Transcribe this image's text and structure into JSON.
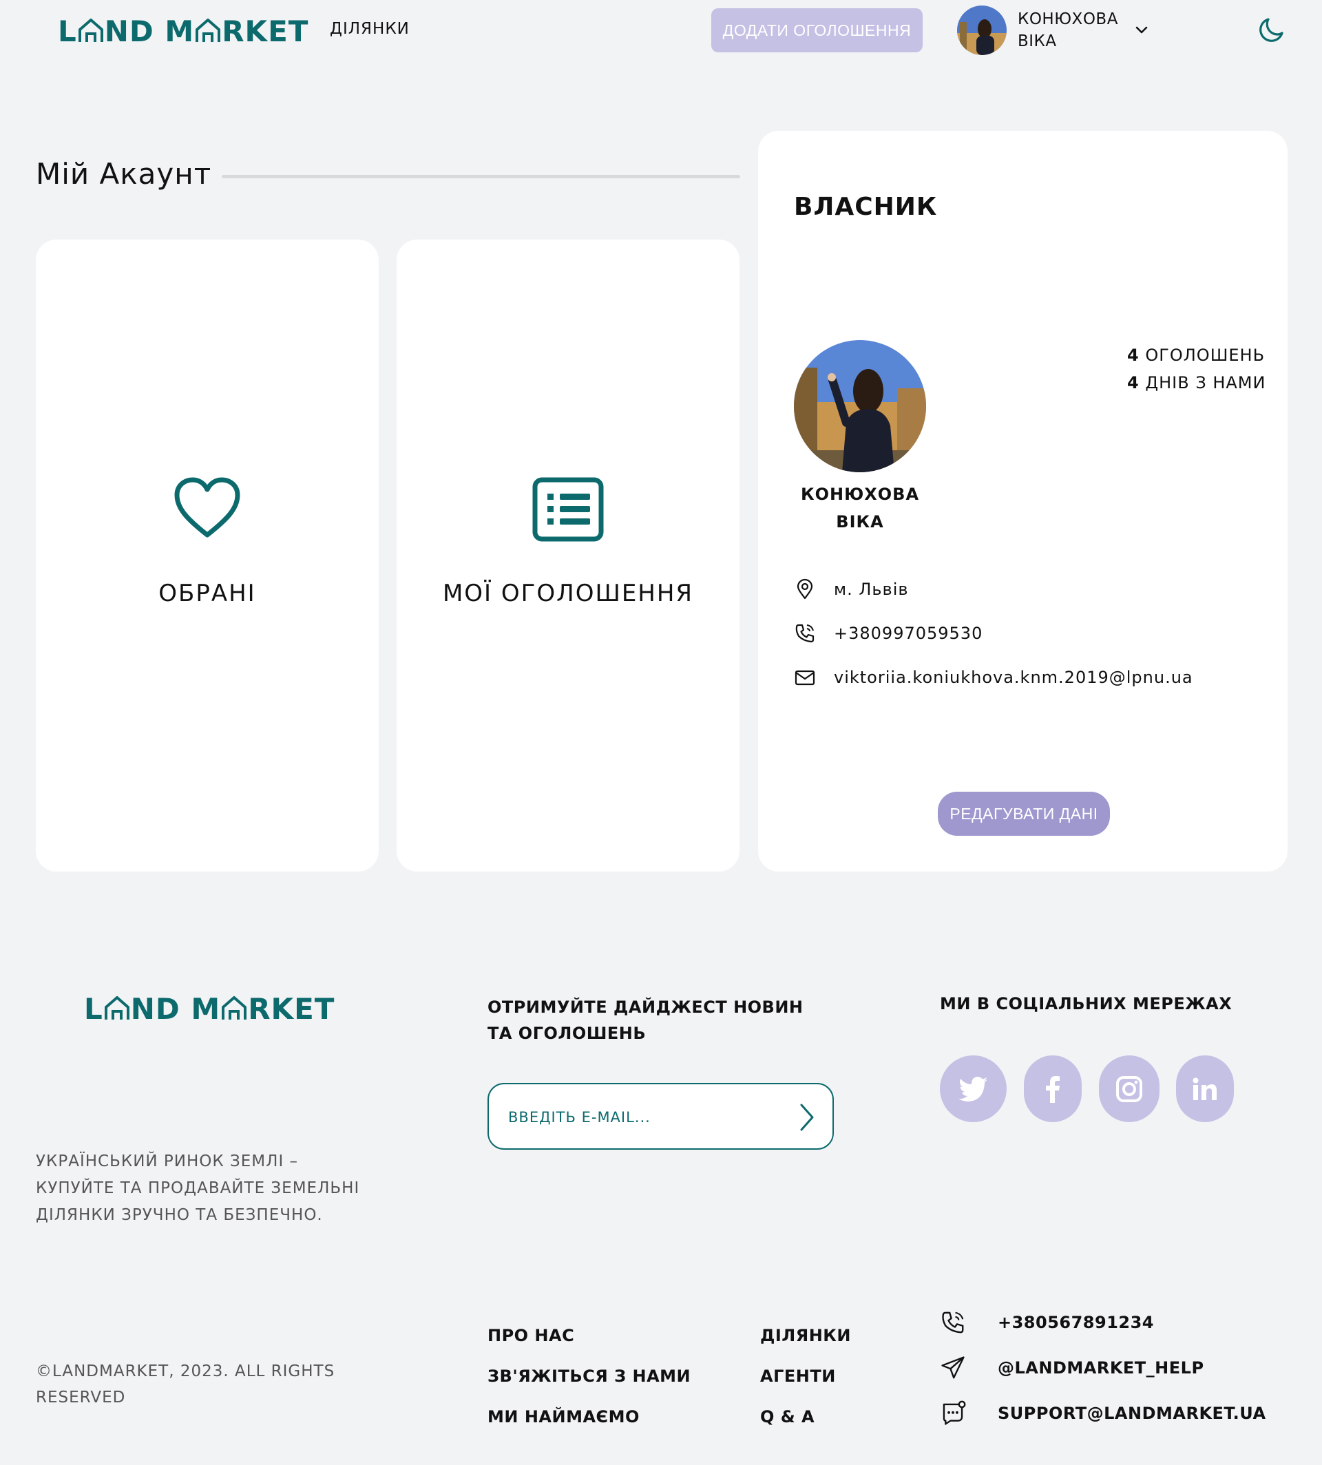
{
  "brand": {
    "logo_left": "L",
    "logo_mid1": "ND M",
    "logo_right": "RKET",
    "accent": "#0c6a6d",
    "button_light": "#c5c1e5",
    "button_dark": "#9e98cf"
  },
  "header": {
    "nav_plots": "ДІЛЯНКИ",
    "add_listing": "ДОДАТИ ОГОЛОШЕННЯ",
    "user_name_line1": "КОНЮХОВА",
    "user_name_line2": "ВІКА",
    "icons": {
      "user_menu": "chevron-down-icon",
      "theme": "moon-icon"
    }
  },
  "account": {
    "title": "Мій Акаунт",
    "tiles": [
      {
        "label": "ОБРАНІ",
        "icon": "heart-icon"
      },
      {
        "label": "МОЇ ОГОЛОШЕННЯ",
        "icon": "list-icon"
      }
    ]
  },
  "owner": {
    "heading": "ВЛАСНИК",
    "name_line1": "КОНЮХОВА",
    "name_line2": "ВІКА",
    "listings_count": "4",
    "listings_label": "ОГОЛОШЕНЬ",
    "days_count": "4",
    "days_label": "ДНІВ З НАМИ",
    "city": "м. Львів",
    "phone": "+380997059530",
    "email": "viktoriia.koniukhova.knm.2019@lpnu.ua",
    "edit_button": "РЕДАГУВАТИ ДАНІ"
  },
  "footer": {
    "tagline": "УКРАЇНСЬКИЙ РИНОК ЗЕМЛІ – КУПУЙТЕ ТА ПРОДАВАЙТЕ ЗЕМЕЛЬНІ ДІЛЯНКИ ЗРУЧНО ТА БЕЗПЕЧНО.",
    "copyright": "©LANDMARKET, 2023. ALL RIGHTS RESERVED",
    "digest_heading": "ОТРИМУЙТЕ ДАЙДЖЕСТ НОВИН ТА ОГОЛОШЕНЬ",
    "email_placeholder": "ВВЕДІТЬ E-MAIL...",
    "social_heading": "МИ В СОЦІАЛЬНИХ МЕРЕЖАХ",
    "social": [
      "twitter-icon",
      "facebook-icon",
      "instagram-icon",
      "linkedin-icon"
    ],
    "links": {
      "about": "ПРО НАС",
      "contact": "ЗВ'ЯЖІТЬСЯ З НАМИ",
      "hiring": "МИ НАЙМАЄМО",
      "plots": "ДІЛЯНКИ",
      "agents": "АГЕНТИ",
      "qa": "Q & A"
    },
    "contacts": {
      "phone": "+380567891234",
      "telegram": "@LANDMARKET_HELP",
      "support": "SUPPORT@LANDMARKET.UA"
    }
  }
}
